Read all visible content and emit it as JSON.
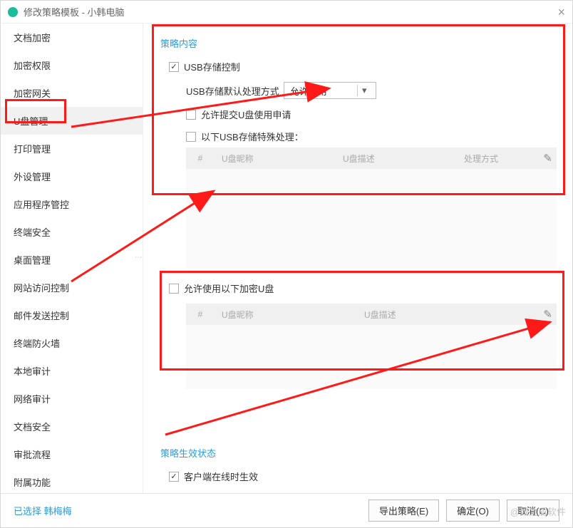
{
  "title": "修改策略模板 - 小韩电脑",
  "sidebar": {
    "items": [
      {
        "label": "文档加密"
      },
      {
        "label": "加密权限"
      },
      {
        "label": "加密网关"
      },
      {
        "label": "U盘管理",
        "selected": true
      },
      {
        "label": "打印管理"
      },
      {
        "label": "外设管理"
      },
      {
        "label": "应用程序管控"
      },
      {
        "label": "终端安全"
      },
      {
        "label": "桌面管理"
      },
      {
        "label": "网站访问控制"
      },
      {
        "label": "邮件发送控制"
      },
      {
        "label": "终端防火墙"
      },
      {
        "label": "本地审计"
      },
      {
        "label": "网络审计"
      },
      {
        "label": "文档安全"
      },
      {
        "label": "审批流程"
      },
      {
        "label": "附属功能"
      }
    ]
  },
  "section1": {
    "title": "策略内容",
    "usb_control_label": "USB存储控制",
    "usb_control_checked": true,
    "default_mode_label": "USB存储默认处理方式",
    "default_mode_value": "允许使用",
    "allow_apply_label": "允许提交U盘使用申请",
    "allow_apply_checked": false,
    "special_label": "以下USB存储特殊处理：",
    "special_checked": false,
    "table1_cols": {
      "num": "#",
      "nick": "U盘昵称",
      "desc": "U盘描述",
      "handle": "处理方式"
    }
  },
  "section2": {
    "encrypt_allow_label": "允许使用以下加密U盘",
    "encrypt_allow_checked": false,
    "table2_cols": {
      "num": "#",
      "nick": "U盘昵称",
      "desc": "U盘描述"
    }
  },
  "section3": {
    "title": "策略生效状态",
    "online_label": "客户端在线时生效",
    "online_checked": true
  },
  "footer": {
    "selected_text": "已选择 韩梅梅",
    "export_label": "导出策略(E)",
    "ok_label": "确定(O)",
    "cancel_label": "取消(C)"
  },
  "watermark": "@域之盾软件"
}
